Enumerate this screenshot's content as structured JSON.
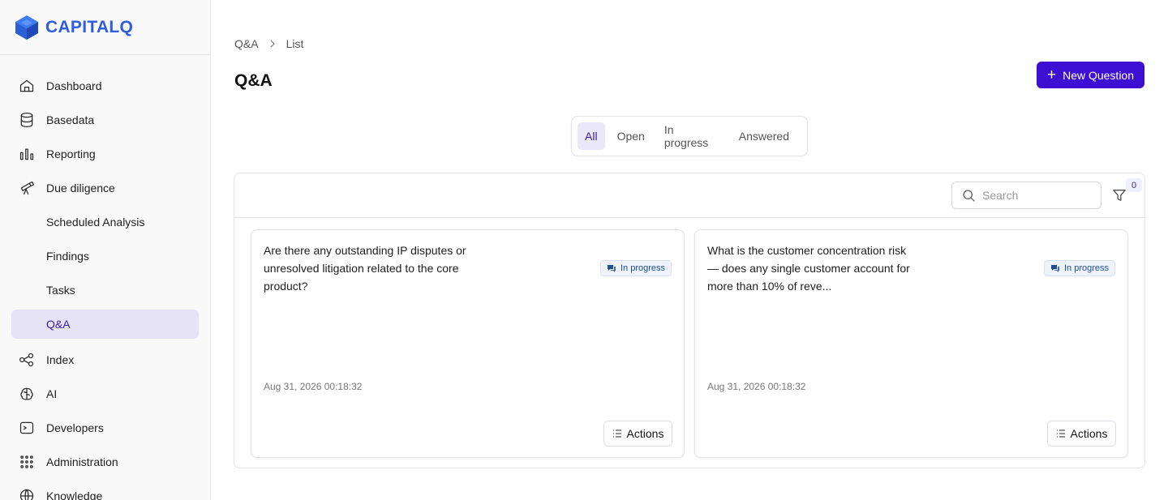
{
  "brand": {
    "name": "CAPITALQ",
    "color": "#2f5ce0"
  },
  "accent": "#3d0fd3",
  "sidebar": {
    "items": [
      {
        "label": "Dashboard",
        "icon": "home-icon"
      },
      {
        "label": "Basedata",
        "icon": "database-icon"
      },
      {
        "label": "Reporting",
        "icon": "bar-chart-icon"
      },
      {
        "label": "Due diligence",
        "icon": "telescope-icon"
      },
      {
        "label": "Scheduled Analysis",
        "icon": ""
      },
      {
        "label": "Findings",
        "icon": ""
      },
      {
        "label": "Tasks",
        "icon": ""
      },
      {
        "label": "Q&A",
        "icon": "",
        "active": true
      },
      {
        "label": "Index",
        "icon": "share-nodes-icon"
      },
      {
        "label": "AI",
        "icon": "brain-icon"
      },
      {
        "label": "Developers",
        "icon": "terminal-icon"
      },
      {
        "label": "Administration",
        "icon": "grid-dots-icon"
      },
      {
        "label": "Knowledge",
        "icon": "globe-icon"
      }
    ]
  },
  "breadcrumb": {
    "root": "Q&A",
    "current": "List"
  },
  "page": {
    "title": "Q&A",
    "new_button": "New Question"
  },
  "tabs": [
    {
      "label": "All",
      "active": true
    },
    {
      "label": "Open"
    },
    {
      "label": "In progress"
    },
    {
      "label": "Answered"
    }
  ],
  "toolbar": {
    "search_placeholder": "Search",
    "filter_count": "0"
  },
  "cards": [
    {
      "question": "Are there any outstanding IP disputes or unresolved litigation related to the core product?",
      "status": "In progress",
      "timestamp": "Aug 31, 2026 00:18:32",
      "actions_label": "Actions"
    },
    {
      "question": "What is the customer concentration risk — does any single customer account for more than 10% of reve...",
      "status": "In progress",
      "timestamp": "Aug 31, 2026 00:18:32",
      "actions_label": "Actions"
    }
  ]
}
